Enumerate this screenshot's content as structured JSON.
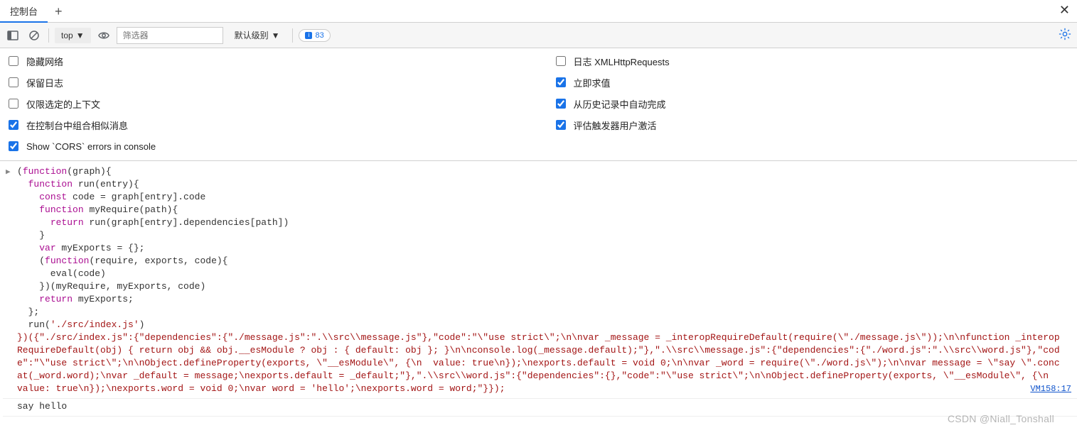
{
  "tabs": {
    "active": "控制台"
  },
  "toolbar": {
    "context": "top",
    "filter_placeholder": "筛选器",
    "level": "默认级别",
    "issue_count": "83"
  },
  "settings": {
    "left": [
      {
        "label": "隐藏网络",
        "checked": false
      },
      {
        "label": "保留日志",
        "checked": false
      },
      {
        "label": "仅限选定的上下文",
        "checked": false
      },
      {
        "label": "在控制台中组合相似消息",
        "checked": true
      },
      {
        "label": "Show `CORS` errors in console",
        "checked": true
      }
    ],
    "right": [
      {
        "label": "日志 XMLHttpRequests",
        "checked": false
      },
      {
        "label": "立即求值",
        "checked": true
      },
      {
        "label": "从历史记录中自动完成",
        "checked": true
      },
      {
        "label": "评估触发器用户激活",
        "checked": true
      }
    ]
  },
  "console": {
    "vm_link": "VM158:17",
    "output": "say hello",
    "code": {
      "l1_a": "(",
      "l1_b": "function",
      "l1_c": "(graph){",
      "l2_a": "  ",
      "l2_b": "function",
      "l2_c": " run(entry){",
      "l3_a": "    ",
      "l3_b": "const",
      "l3_c": " code = graph[entry].code",
      "l4_a": "    ",
      "l4_b": "function",
      "l4_c": " myRequire(path){",
      "l5_a": "      ",
      "l5_b": "return",
      "l5_c": " run(graph[entry].dependencies[path])",
      "l6": "    }",
      "l7_a": "    ",
      "l7_b": "var",
      "l7_c": " myExports = {};",
      "l8_a": "    (",
      "l8_b": "function",
      "l8_c": "(require, exports, code){",
      "l9_a": "      eval(code)",
      "l10": "    })(myRequire, myExports, code)",
      "l11_a": "    ",
      "l11_b": "return",
      "l11_c": " myExports;",
      "l12": "  };",
      "l13_a": "  run(",
      "l13_b": "'./src/index.js'",
      "l13_c": ")",
      "obj": "})({\"./src/index.js\":{\"dependencies\":{\"./message.js\":\".\\\\src\\\\message.js\"},\"code\":\"\\\"use strict\\\";\\n\\nvar _message = _interopRequireDefault(require(\\\"./message.js\\\"));\\n\\nfunction _interopRequireDefault(obj) { return obj && obj.__esModule ? obj : { default: obj }; }\\n\\nconsole.log(_message.default);\"},\".\\\\src\\\\message.js\":{\"dependencies\":{\"./word.js\":\".\\\\src\\\\word.js\"},\"code\":\"\\\"use strict\\\";\\n\\nObject.defineProperty(exports, \\\"__esModule\\\", {\\n  value: true\\n});\\nexports.default = void 0;\\n\\nvar _word = require(\\\"./word.js\\\");\\n\\nvar message = \\\"say \\\".concat(_word.word);\\nvar _default = message;\\nexports.default = _default;\"},\".\\\\src\\\\word.js\":{\"dependencies\":{},\"code\":\"\\\"use strict\\\";\\n\\nObject.defineProperty(exports, \\\"__esModule\\\", {\\n  value: true\\n});\\nexports.word = void 0;\\nvar word = 'hello';\\nexports.word = word;\"}});"
    }
  },
  "watermark": "CSDN @Niall_Tonshall"
}
